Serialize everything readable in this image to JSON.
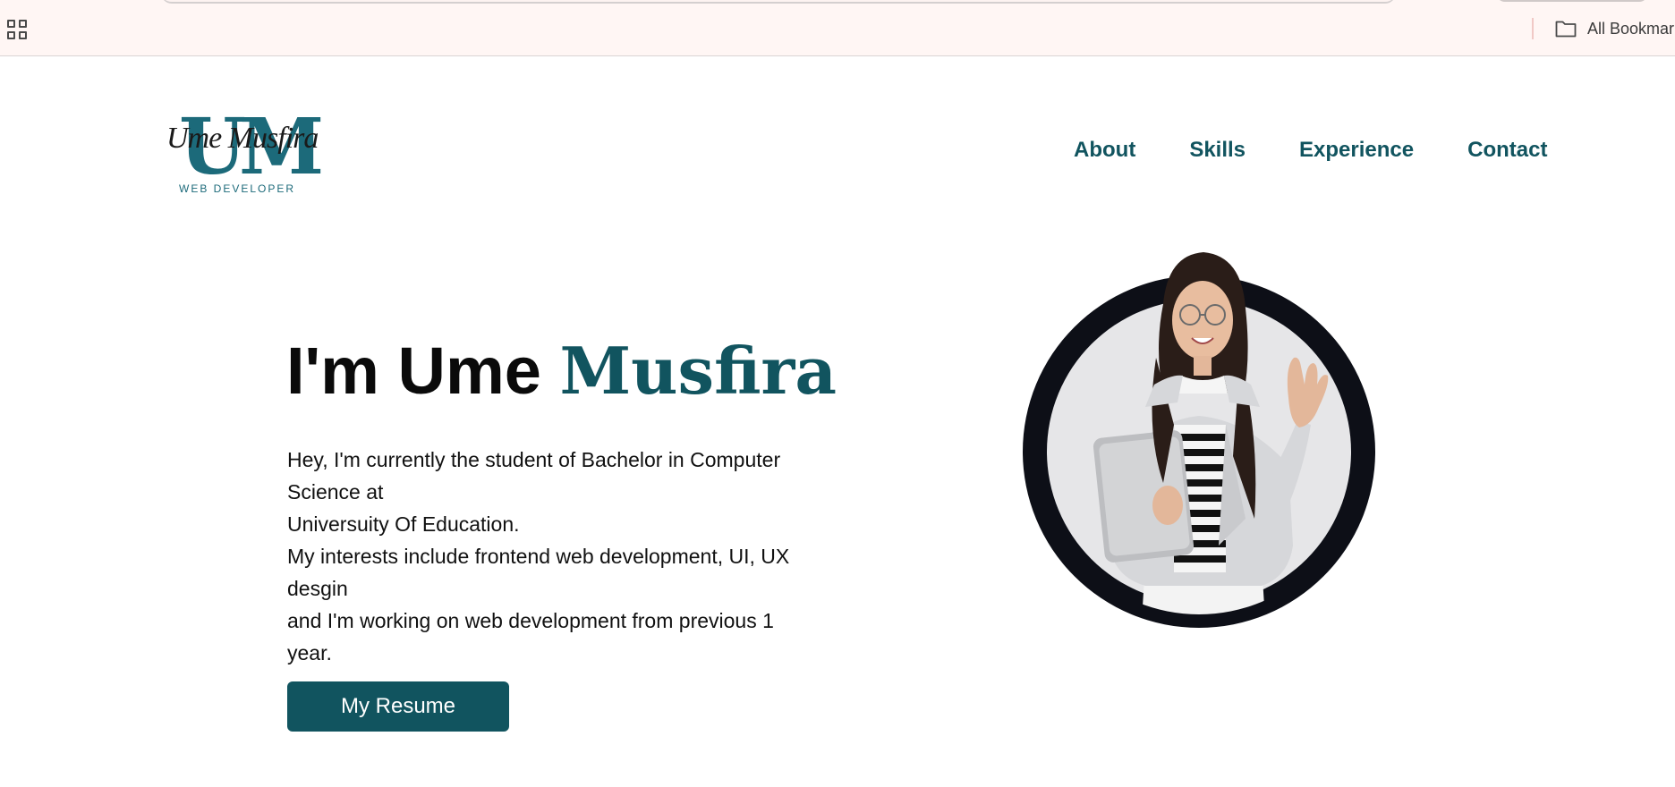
{
  "browser": {
    "all_bookmarks_label": "All Bookmar"
  },
  "site": {
    "logo": {
      "letters": "UM",
      "script": "Ume Musfira",
      "tagline": "WEB DEVELOPER"
    },
    "nav": [
      {
        "label": "About"
      },
      {
        "label": "Skills"
      },
      {
        "label": "Experience"
      },
      {
        "label": "Contact"
      }
    ]
  },
  "hero": {
    "greeting": "I'm Ume",
    "name_accent": "Musfira",
    "paragraph_lines": [
      "Hey, I'm currently the student of Bachelor in Computer Science at",
      "Universuity Of Education.",
      "My interests include frontend web development, UI, UX desgin",
      "and I'm working on web development from previous 1 year."
    ],
    "resume_button": "My Resume"
  },
  "colors": {
    "accent": "#11545f",
    "logo": "#1c6a7a",
    "bookmarks_bar_bg": "#fff6f4",
    "portrait_ring": "#0d0f17"
  },
  "icons": {
    "apps": "apps-grid-icon",
    "folder": "folder-icon"
  }
}
